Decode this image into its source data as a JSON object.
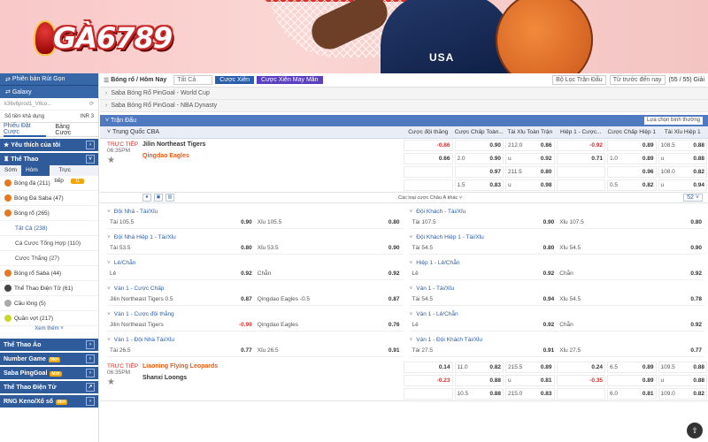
{
  "brand": {
    "logo_text": "GÀ6789"
  },
  "banner": {
    "jersey_text": "USA"
  },
  "sidebar": {
    "top_label": "Phiên bản Rút Gọn",
    "galaxy_label": "Galaxy",
    "username": "k36v6prod1_V6co...",
    "balance_label": "Số tiền khả dụng",
    "balance_value": "INR 3",
    "tabs": [
      "Phiếu Đặt Cược",
      "Bảng Cược"
    ],
    "favorites": "Yêu thích của tôi",
    "sports_title": "Thể Thao",
    "sub_tabs": [
      "Sớm",
      "Hôm Nay",
      "Trực tiếp"
    ],
    "live_badge": "11",
    "items": [
      {
        "label": "Bóng đá",
        "count": "(211)"
      },
      {
        "label": "Bóng Đá Saba",
        "count": "(47)"
      },
      {
        "label": "Bóng rổ",
        "count": "(265)"
      }
    ],
    "basketball_subs": [
      {
        "label": "Tất Cả",
        "count": "(238)"
      },
      {
        "label": "Cá Cược Tổng Hợp",
        "count": "(110)"
      },
      {
        "label": "Cược Thắng",
        "count": "(27)"
      }
    ],
    "items2": [
      {
        "label": "Bóng rổ Saba",
        "count": "(44)"
      },
      {
        "label": "Thể Thao Điện Tử",
        "count": "(61)"
      },
      {
        "label": "Cầu lông",
        "count": "(5)"
      },
      {
        "label": "Quần vợt",
        "count": "(217)"
      }
    ],
    "more": "Xem thêm",
    "sections": [
      "Thể Thao Ảo",
      "Number Game",
      "Saba PingGoal",
      "Thể Thao Điện Tử",
      "RNG Keno/Xổ số"
    ],
    "new_badge": "Mới"
  },
  "toolbar": {
    "crumb": "Bóng rổ / Hôm Nay",
    "select": "Tất Cả",
    "parlay": "Cược Xiên",
    "random_parlay": "Cược Xiên May Mắn",
    "filter": "Bộ Lọc Trận Đấu",
    "sort": "Từ trước đến nay",
    "count": "(55 / 55) Giải"
  },
  "worldcup": "Saba Bóng Rổ PinGoal - World Cup",
  "nba": "Saba Bóng Rổ PinGoal - NBA Dynasty",
  "section_title": "Trận Đấu",
  "sort_select": "Lựa chọn bình thường",
  "league": "Trung Quốc CBA",
  "columns": [
    "Cược đội thắng",
    "Cược Chấp Toàn...",
    "Tài Xỉu Toàn Trận",
    "Hiệp 1 - Cược...",
    "Cược Chấp Hiệp 1",
    "Tài Xỉu Hiệp 1"
  ],
  "match1": {
    "live": "TRỰC TIẾP",
    "time": "06:35PM",
    "home": "Jilin Northeast Tigers",
    "away": "Qingdao Eagles",
    "rows": [
      [
        [
          "",
          "-0.86"
        ],
        [
          "",
          "0.90"
        ],
        [
          "212.0",
          "0.86"
        ],
        [
          "",
          "-0.92"
        ],
        [
          "",
          "0.89"
        ],
        [
          "108.5",
          "0.88"
        ]
      ],
      [
        [
          "",
          "0.66"
        ],
        [
          "2.0",
          "0.90"
        ],
        [
          "u",
          "0.92"
        ],
        [
          "",
          "0.71"
        ],
        [
          "1.0",
          "0.89"
        ],
        [
          "u",
          "0.88"
        ]
      ],
      [
        [
          "",
          ""
        ],
        [
          "",
          "0.97"
        ],
        [
          "211.5",
          "0.80"
        ],
        [
          "",
          ""
        ],
        [
          "",
          "0.96"
        ],
        [
          "108.0",
          "0.82"
        ]
      ],
      [
        [
          "",
          ""
        ],
        [
          "1.5",
          "0.83"
        ],
        [
          "u",
          "0.98"
        ],
        [
          "",
          ""
        ],
        [
          "0.5",
          "0.82"
        ],
        [
          "u",
          "0.94"
        ]
      ]
    ],
    "footer_mid": "Các loại cược Châu Á khác",
    "footer_count": "52"
  },
  "markets": [
    {
      "title": "Đội Nhà - Tài/Xỉu",
      "a": "Tài 105.5",
      "av": "0.90",
      "b": "Xỉu 105.5",
      "bv": "0.80"
    },
    {
      "title": "Đội Khách - Tài/Xỉu",
      "a": "Tài 107.5",
      "av": "0.90",
      "b": "Xỉu 107.5",
      "bv": "0.80"
    },
    {
      "title": "Đội Nhà Hiệp 1 - Tài/Xỉu",
      "a": "Tài 53.5",
      "av": "0.80",
      "b": "Xỉu 53.5",
      "bv": "0.90"
    },
    {
      "title": "Đội Khách Hiệp 1 - Tài/Xỉu",
      "a": "Tài 54.5",
      "av": "0.80",
      "b": "Xỉu 54.5",
      "bv": "0.90"
    },
    {
      "title": "Lẻ/Chẵn",
      "a": "Lẻ",
      "av": "0.92",
      "b": "Chẵn",
      "bv": "0.92"
    },
    {
      "title": "Hiệp 1 - Lẻ/Chẵn",
      "a": "Lẻ",
      "av": "0.92",
      "b": "Chẵn",
      "bv": "0.92"
    },
    {
      "title": "Ván 1 - Cược Chấp",
      "a": "Jilin Northeast Tigers 0.5",
      "av": "0.87",
      "b": "Qingdao Eagles -0.5",
      "bv": "0.87"
    },
    {
      "title": "Ván 1 - Tài/Xỉu",
      "a": "Tài 54.5",
      "av": "0.94",
      "b": "Xỉu 54.5",
      "bv": "0.78"
    },
    {
      "title": "Ván 1 - Cược đội thắng",
      "a": "Jilin Northeast Tigers",
      "av": "-0.99",
      "b": "Qingdao Eagles",
      "bv": "0.76"
    },
    {
      "title": "Ván 1 - Lẻ/Chẵn",
      "a": "Lẻ",
      "av": "0.92",
      "b": "Chẵn",
      "bv": "0.92"
    },
    {
      "title": "Ván 1 - Đội Nhà Tài/Xỉu",
      "a": "Tài 26.5",
      "av": "0.77",
      "b": "Xỉu 26.5",
      "bv": "0.91"
    },
    {
      "title": "Ván 1 - Đội Khách Tài/Xỉu",
      "a": "Tài 27.5",
      "av": "0.91",
      "b": "Xỉu 27.5",
      "bv": "0.77"
    }
  ],
  "match2": {
    "live": "TRỰC TIẾP",
    "time": "06:35PM",
    "home": "Liaoning Flying Leopards",
    "away": "Shanxi Loongs",
    "rows": [
      [
        [
          "",
          "0.14"
        ],
        [
          "11.0",
          "0.82"
        ],
        [
          "215.5",
          "0.89"
        ],
        [
          "",
          "0.24"
        ],
        [
          "6.5",
          "0.89"
        ],
        [
          "109.5",
          "0.88"
        ]
      ],
      [
        [
          "",
          "-0.23"
        ],
        [
          "",
          "0.88"
        ],
        [
          "u",
          "0.81"
        ],
        [
          "",
          "-0.35"
        ],
        [
          "",
          "0.89"
        ],
        [
          "u",
          "0.88"
        ]
      ],
      [
        [
          "",
          ""
        ],
        [
          "10.5",
          "0.88"
        ],
        [
          "215.0",
          "0.83"
        ],
        [
          "",
          ""
        ],
        [
          "6.0",
          "0.81"
        ],
        [
          "109.0",
          "0.82"
        ]
      ]
    ]
  }
}
